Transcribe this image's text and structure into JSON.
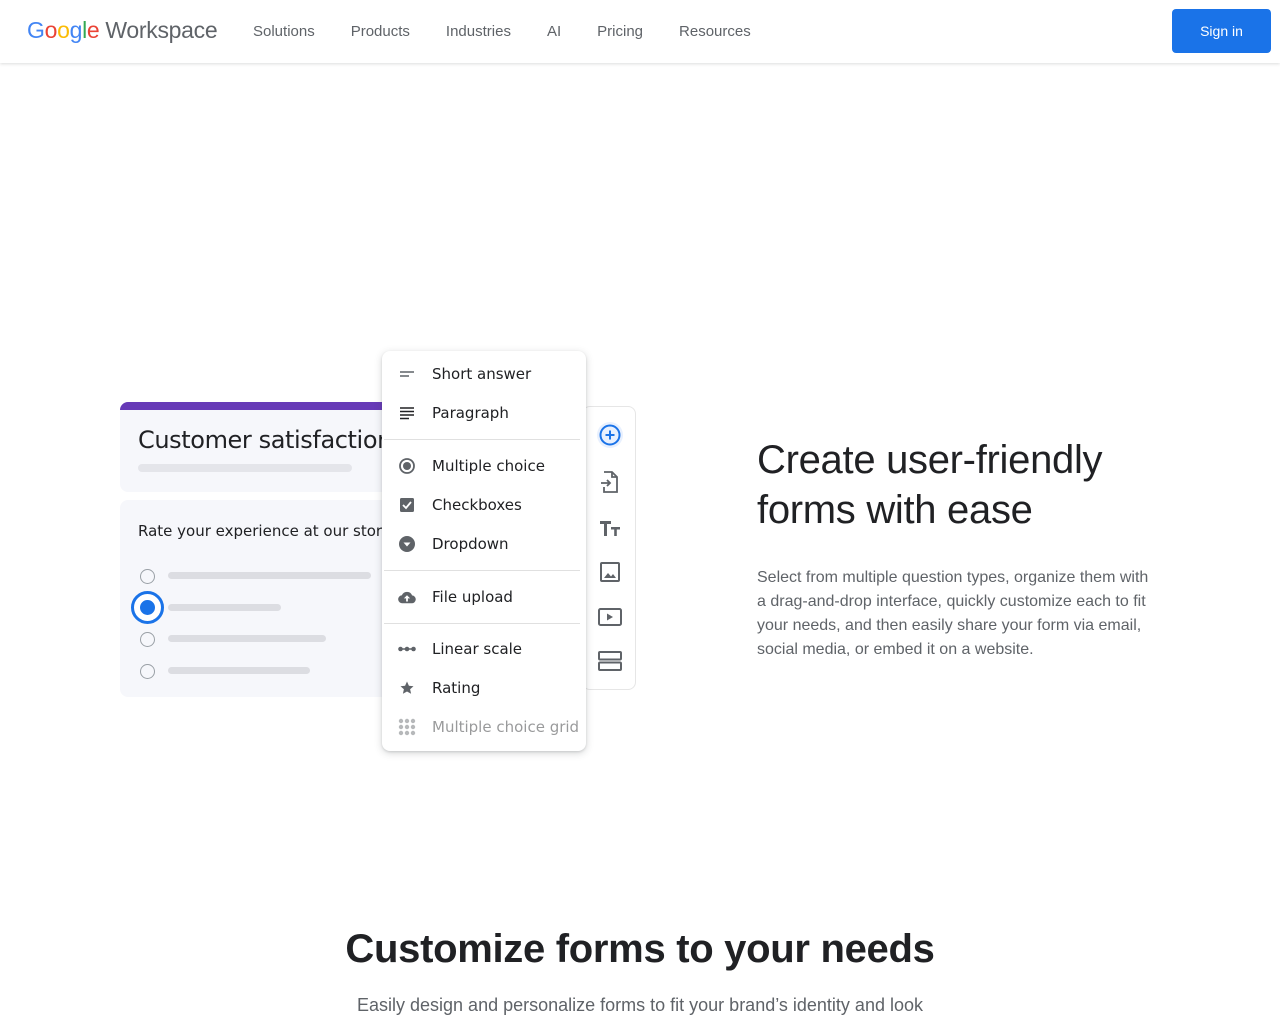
{
  "header": {
    "logo": {
      "google_letters": [
        {
          "char": "G",
          "color": "#4285f4"
        },
        {
          "char": "o",
          "color": "#ea4335"
        },
        {
          "char": "o",
          "color": "#fbbc05"
        },
        {
          "char": "g",
          "color": "#4285f4"
        },
        {
          "char": "l",
          "color": "#34a853"
        },
        {
          "char": "e",
          "color": "#ea4335"
        }
      ],
      "product": "Workspace"
    },
    "nav": [
      "Solutions",
      "Products",
      "Industries",
      "AI",
      "Pricing",
      "Resources"
    ],
    "signin_label": "Sign in",
    "accent_color": "#1a73e8"
  },
  "illustration": {
    "form_title": "Customer satisfaction",
    "question": "Rate your experience at our store",
    "selected_option_index": 1,
    "theme_color": "#673ab7",
    "menu_items": [
      {
        "label": "Short answer",
        "icon": "short-answer-icon"
      },
      {
        "label": "Paragraph",
        "icon": "paragraph-icon"
      },
      {
        "label": "Multiple choice",
        "icon": "radio-button-icon"
      },
      {
        "label": "Checkboxes",
        "icon": "checkbox-icon"
      },
      {
        "label": "Dropdown",
        "icon": "dropdown-icon"
      },
      {
        "label": "File upload",
        "icon": "cloud-upload-icon"
      },
      {
        "label": "Linear scale",
        "icon": "linear-scale-icon"
      },
      {
        "label": "Rating",
        "icon": "star-icon"
      },
      {
        "label": "Multiple choice grid",
        "icon": "grid-icon"
      }
    ],
    "toolbar": [
      "add-question-icon",
      "import-questions-icon",
      "add-title-icon",
      "add-image-icon",
      "add-video-icon",
      "add-section-icon"
    ]
  },
  "feature": {
    "headline": "Create user-friendly forms with ease",
    "description": "Select from multiple question types, organize them with a drag-and-drop interface, quickly customize each to fit your needs, and then easily share your form via email, social media, or embed it on a website."
  },
  "section": {
    "title": "Customize forms to your needs",
    "subtitle": "Easily design and personalize forms to fit your brand’s identity and look"
  }
}
